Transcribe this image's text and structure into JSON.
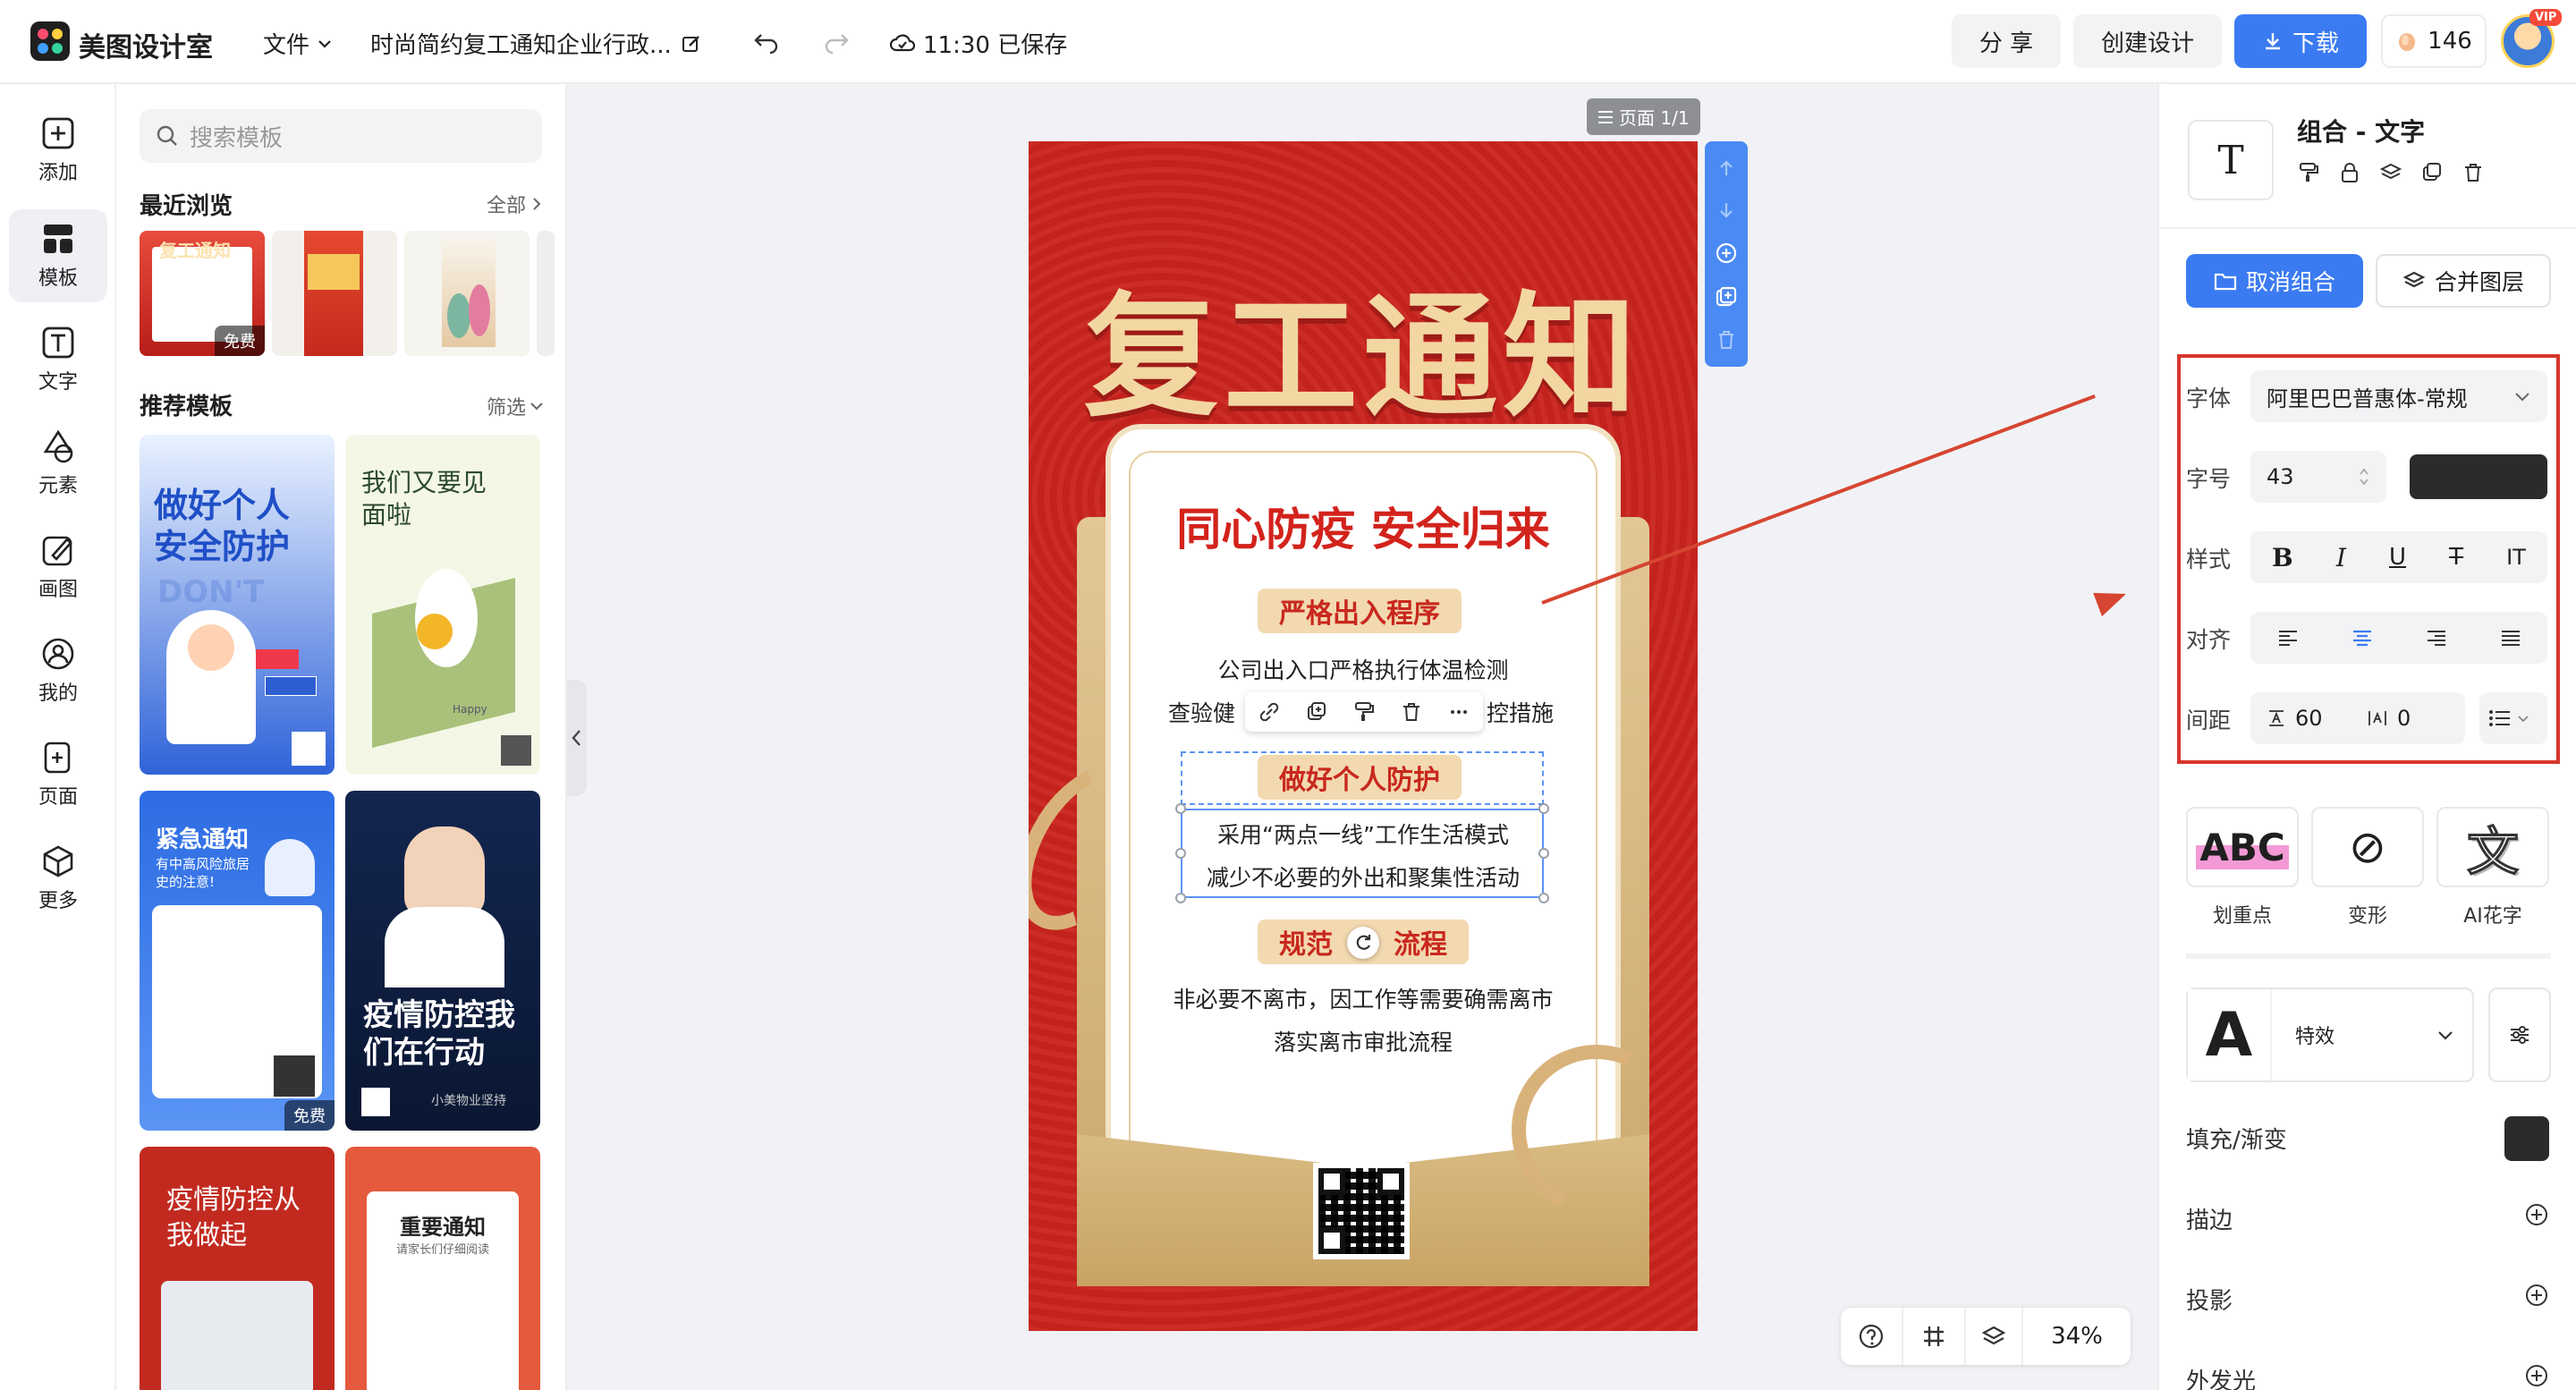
{
  "topbar": {
    "app_name": "美图设计室",
    "file_menu": "文件",
    "doc_title": "时尚简约复工通知企业行政...",
    "save_status": "11:30 已保存",
    "share": "分 享",
    "create": "创建设计",
    "download": "下载",
    "credits": "146",
    "vip": "VIP"
  },
  "leftnav": {
    "items": [
      {
        "label": "添加",
        "icon": "plus-square-icon"
      },
      {
        "label": "模板",
        "icon": "template-grid-icon"
      },
      {
        "label": "文字",
        "icon": "text-icon"
      },
      {
        "label": "元素",
        "icon": "shapes-icon"
      },
      {
        "label": "画图",
        "icon": "draw-icon"
      },
      {
        "label": "我的",
        "icon": "user-icon"
      },
      {
        "label": "页面",
        "icon": "page-add-icon"
      },
      {
        "label": "更多",
        "icon": "box-icon"
      }
    ]
  },
  "templates": {
    "search_placeholder": "搜索模板",
    "recent_title": "最近浏览",
    "recent_more": "全部",
    "recent_free": "免费",
    "recommend_title": "推荐模板",
    "recommend_filter": "筛选",
    "cards": [
      {
        "title": "做好个人安全防护",
        "sub": "DON'T"
      },
      {
        "title": "我们又要见面啦",
        "sub": "Happy"
      },
      {
        "title": "紧急通知",
        "sub": "有中高风险旅居史的注意!"
      },
      {
        "title": "疫情防控我们在行动",
        "sub": "小美物业坚持"
      },
      {
        "title": "疫情防控从我做起",
        "sub": ""
      },
      {
        "title": "重要通知",
        "sub": "请家长们仔细阅读"
      }
    ],
    "card_free": "免费"
  },
  "canvas": {
    "page_label": "页面 1/1",
    "zoom": "34%"
  },
  "poster": {
    "title": "复工通知",
    "slogan": "同心防疫 安全归来",
    "sections": [
      {
        "heading": "严格出入程序",
        "lines": [
          "公司出入口严格执行体温检测",
          "查验健",
          "控措施"
        ]
      },
      {
        "heading": "做好个人防护",
        "lines": [
          "采用“两点一线”工作生活模式",
          "减少不必要的外出和聚集性活动"
        ]
      },
      {
        "heading": "规范",
        "heading_tail": "流程",
        "lines": [
          "非必要不离市，因工作等需要确需离市",
          "落实离市审批流程"
        ]
      }
    ]
  },
  "rightpanel": {
    "type_thumb": "T",
    "type_name": "组合 - 文字",
    "ungroup": "取消组合",
    "merge": "合并图层",
    "font_label": "字体",
    "font_value": "阿里巴巴普惠体-常规",
    "size_label": "字号",
    "size_value": "43",
    "text_color": "#2b2b2b",
    "style_label": "样式",
    "style_buttons": [
      "B",
      "I",
      "U",
      "T",
      "IT"
    ],
    "align_label": "对齐",
    "spacing_label": "间距",
    "line_spacing": "60",
    "letter_spacing": "0",
    "fx": [
      {
        "label": "划重点",
        "glyph": "ABC"
      },
      {
        "label": "变形",
        "glyph": "⊘"
      },
      {
        "label": "AI花字",
        "glyph": "文"
      }
    ],
    "effect_glyph": "A",
    "effect_label": "特效",
    "fill_label": "填充/渐变",
    "fill_color": "#2b2b2b",
    "stroke_label": "描边",
    "shadow_label": "投影",
    "glow_label": "外发光"
  },
  "colors": {
    "accent": "#3b7bf2",
    "poster_red": "#c9241e",
    "gold": "#f2d7a2",
    "highlight_red": "#d6362c"
  }
}
